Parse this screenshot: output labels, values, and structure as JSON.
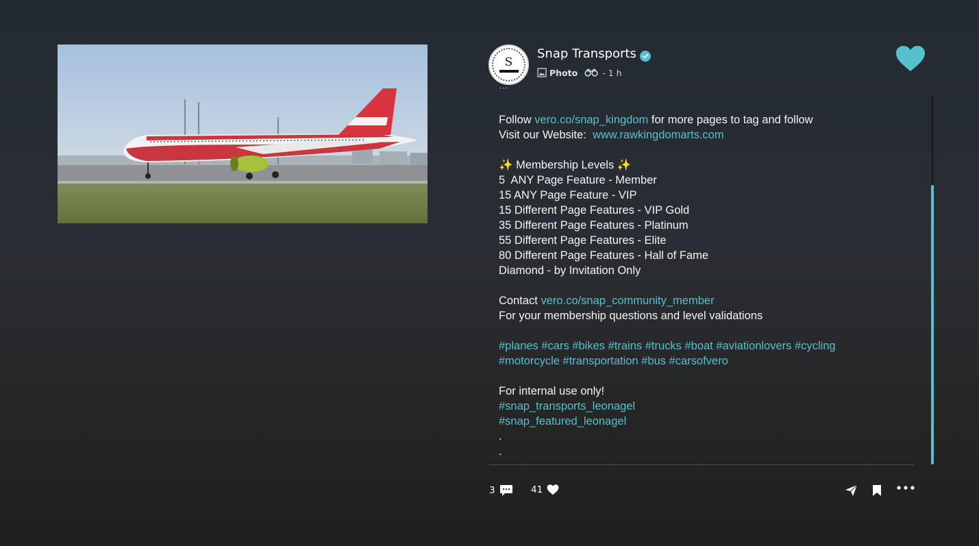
{
  "post": {
    "author": "Snap Transports",
    "avatar_letter": "S",
    "type_label": "Photo",
    "time": "1 h"
  },
  "caption": {
    "clipped_line": "...",
    "follow_prefix": "Follow ",
    "follow_link": "vero.co/snap_kingdom",
    "follow_suffix": " for more pages to tag and follow",
    "visit_prefix": "Visit our Website:  ",
    "visit_link": "www.rawkingdomarts.com",
    "membership_title": "✨ Membership Levels ✨",
    "levels": [
      "5  ANY Page Feature - Member",
      "15 ANY Page Feature - VIP",
      "15 Different Page Features - VIP Gold",
      "35 Different Page Features - Platinum",
      "55 Different Page Features - Elite",
      "80 Different Page Features - Hall of Fame",
      "Diamond - by Invitation Only"
    ],
    "contact_prefix": "Contact ",
    "contact_link": "vero.co/snap_community_member",
    "contact_note": "For your membership questions and level validations",
    "hashtags_line1": "#planes #cars #bikes #trains #trucks #boat #aviationlovers #cycling",
    "hashtags_line2": "#motorcycle #transportation #bus #carsofvero",
    "internal_note": "For internal use only!",
    "tag1": "#snap_transports_leonagel",
    "tag2": "#snap_featured_leonagel",
    "dot1": ".",
    "dot2": "."
  },
  "actions": {
    "comments_count": "3",
    "likes_count": "41"
  },
  "colors": {
    "accent": "#56c1cc",
    "background": "#262b31",
    "text": "#f4f4f4"
  },
  "icons": {
    "verified": "verified-badge-icon",
    "photo": "image-icon",
    "visibility": "binoculars-icon",
    "like": "heart-icon",
    "comment": "comment-bubble-icon",
    "share": "paper-plane-icon",
    "bookmark": "bookmark-icon",
    "more": "more-dots-icon"
  }
}
